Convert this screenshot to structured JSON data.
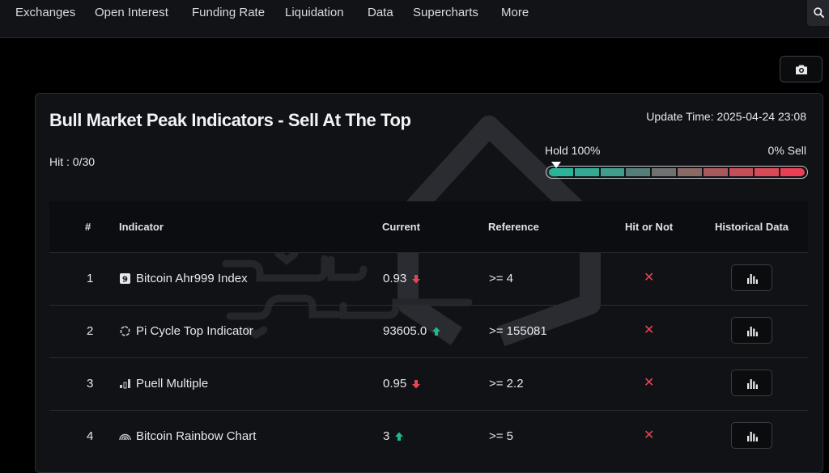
{
  "nav": {
    "items": [
      "Exchanges",
      "Open Interest",
      "Funding Rate",
      "Liquidation",
      "Data",
      "Supercharts",
      "More"
    ]
  },
  "icons": {
    "search": "search-icon",
    "camera": "camera-icon",
    "chart": "bar-chart-icon"
  },
  "panel": {
    "title": "Bull Market Peak Indicators - Sell At The Top",
    "update_time": "Update Time: 2025-04-24 23:08",
    "hit_count": "Hit : 0/30",
    "gauge": {
      "hold_label": "Hold 100%",
      "sell_label": "0% Sell",
      "hold_percent": 100,
      "colors": [
        "#2bb39a",
        "#34a892",
        "#3f9d8b",
        "#567e79",
        "#707270",
        "#8a6a64",
        "#a9585b",
        "#c44f58",
        "#d94a57",
        "#ea3e52"
      ]
    }
  },
  "table": {
    "headers": {
      "num": "#",
      "indicator": "Indicator",
      "current": "Current",
      "reference": "Reference",
      "hit": "Hit or Not",
      "history": "Historical Data"
    },
    "rows": [
      {
        "num": "1",
        "indicator": "Bitcoin Ahr999 Index",
        "icon": "ahr999-badge-icon",
        "current": "0.93",
        "trend": "down",
        "reference": ">= 4",
        "hit": "✕"
      },
      {
        "num": "2",
        "indicator": "Pi Cycle Top Indicator",
        "icon": "cycle-icon",
        "current": "93605.0",
        "trend": "up",
        "reference": ">= 155081",
        "hit": "✕"
      },
      {
        "num": "3",
        "indicator": "Puell Multiple",
        "icon": "puell-icon",
        "current": "0.95",
        "trend": "down",
        "reference": ">= 2.2",
        "hit": "✕"
      },
      {
        "num": "4",
        "indicator": "Bitcoin Rainbow Chart",
        "icon": "rainbow-icon",
        "current": "3",
        "trend": "up",
        "reference": ">= 5",
        "hit": "✕"
      }
    ]
  },
  "colors": {
    "up": "#1fb894",
    "down": "#e64555",
    "miss": "#e64555"
  }
}
